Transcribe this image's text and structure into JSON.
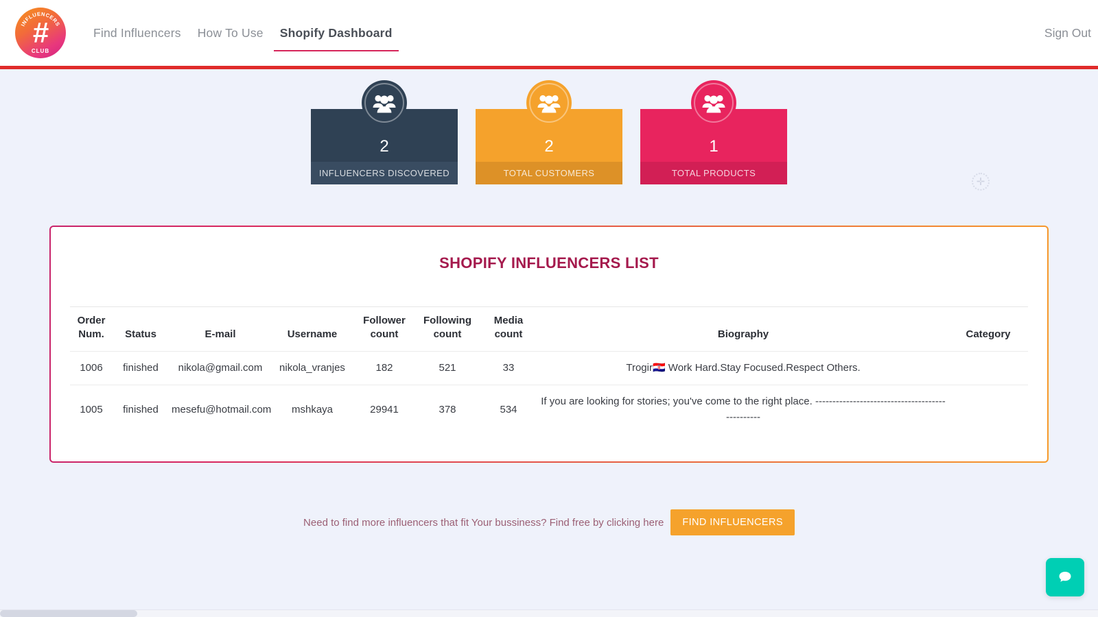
{
  "nav": {
    "logo": {
      "arc_text": "INFLUENCERS",
      "hash": "#",
      "club": "CLUB"
    },
    "links": [
      {
        "label": "Find Influencers",
        "active": false
      },
      {
        "label": "How To Use",
        "active": false
      },
      {
        "label": "Shopify Dashboard",
        "active": true
      }
    ],
    "signout_label": "Sign Out",
    "accent_rule_color": "#e02b2b"
  },
  "stats": [
    {
      "value": "2",
      "label": "INFLUENCERS DISCOVERED",
      "color": "#2f4154",
      "footer_color": "#394c61",
      "icon": "people-icon"
    },
    {
      "value": "2",
      "label": "TOTAL CUSTOMERS",
      "color": "#f5a22c",
      "footer_color": "#dd9127",
      "icon": "people-icon"
    },
    {
      "value": "1",
      "label": "TOTAL PRODUCTS",
      "color": "#e8245e",
      "footer_color": "#d21f55",
      "icon": "people-icon"
    }
  ],
  "ghost_handle": {
    "icon": "move-plus-icon",
    "glyph": "✛"
  },
  "panel": {
    "title": "SHOPIFY INFLUENCERS LIST",
    "title_color": "#a51a4d",
    "border_gradient_from": "#c8246b",
    "border_gradient_to": "#f79a2a",
    "columns": [
      "Order Num.",
      "Status",
      "E-mail",
      "Username",
      "Follower count",
      "Following count",
      "Media count",
      "Biography",
      "Category"
    ],
    "columns_split": [
      {
        "line1": "Order",
        "line2": "Num."
      },
      {
        "line1": "",
        "line2": "Status"
      },
      {
        "line1": "",
        "line2": "E-mail"
      },
      {
        "line1": "",
        "line2": "Username"
      },
      {
        "line1": "Follower",
        "line2": "count"
      },
      {
        "line1": "Following",
        "line2": "count"
      },
      {
        "line1": "Media",
        "line2": "count"
      },
      {
        "line1": "",
        "line2": "Biography"
      },
      {
        "line1": "",
        "line2": "Category"
      }
    ],
    "rows": [
      {
        "order_num": "1006",
        "status": "finished",
        "email": "nikola@gmail.com",
        "username": "nikola_vranjes",
        "follower_count": "182",
        "following_count": "521",
        "media_count": "33",
        "biography": "Trogir🇭🇷 Work Hard.Stay Focused.Respect Others.",
        "category": ""
      },
      {
        "order_num": "1005",
        "status": "finished",
        "email": "mesefu@hotmail.com",
        "username": "mshkaya",
        "follower_count": "29941",
        "following_count": "378",
        "media_count": "534",
        "biography": "If you are looking for stories; you've come to the right place. ------------------------------------------------",
        "category": ""
      }
    ]
  },
  "cta": {
    "text": "Need to find more influencers that fit Your bussiness? Find free by clicking here",
    "button_label": "FIND INFLUENCERS",
    "button_color": "#f5a22c"
  },
  "chat": {
    "icon": "chat-bubble-icon",
    "color": "#00cfb4"
  }
}
